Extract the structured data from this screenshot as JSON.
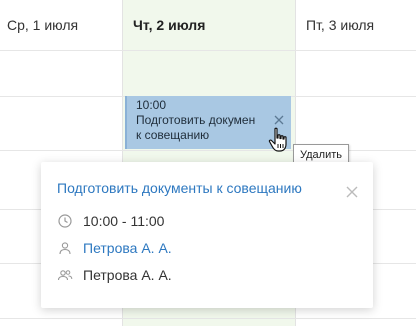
{
  "calendar": {
    "days": [
      {
        "label": "Ср, 1 июля",
        "today": false
      },
      {
        "label": "Чт, 2 июля",
        "today": true
      },
      {
        "label": "Пт, 3 июля",
        "today": false
      }
    ]
  },
  "event": {
    "time": "10:00",
    "title_line1": "Подготовить докумен",
    "title_line2": "к совещанию",
    "delete_tooltip": "Удалить"
  },
  "popup": {
    "title": "Подготовить документы к совещанию",
    "time_range": "10:00 - 11:00",
    "organizer": "Петрова А. А.",
    "participants": "Петрова А. А.",
    "icons": {
      "close": "close-icon",
      "time": "clock-icon",
      "organizer": "person-icon",
      "participants": "people-icon"
    }
  },
  "colors": {
    "accent": "#2d78c0",
    "today_column": "#f1f8ec",
    "event_bg": "#a9c8e3"
  }
}
